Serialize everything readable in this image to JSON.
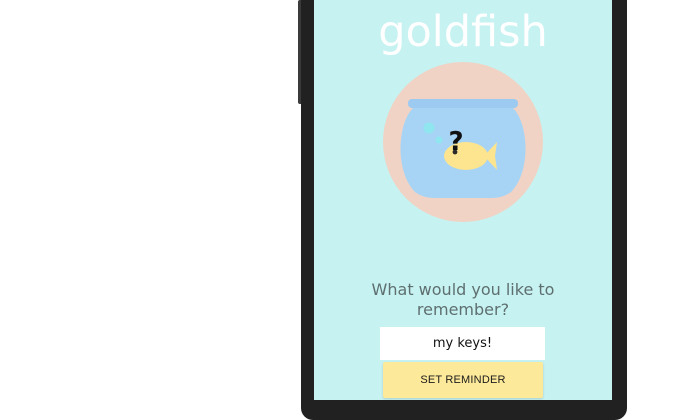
{
  "app": {
    "title": "goldfish"
  },
  "logo": {
    "icon": "goldfish-bowl-icon",
    "question_mark": "?"
  },
  "prompt": {
    "line1": "What would you like to",
    "line2": "remember?"
  },
  "reminder_input": {
    "value": "my keys!"
  },
  "set_button": {
    "label": "SET REMINDER"
  },
  "colors": {
    "screen_background": "#c6f2f1",
    "logo_circle": "#f0d3c5",
    "bowl_water": "#a7d4f5",
    "bowl_rim": "#9ccaf0",
    "fish": "#fde48e",
    "bubbles": "#8fe6ee",
    "button_background": "#fde99a",
    "prompt_text": "#5f6f70",
    "phone_frame": "#212121"
  }
}
